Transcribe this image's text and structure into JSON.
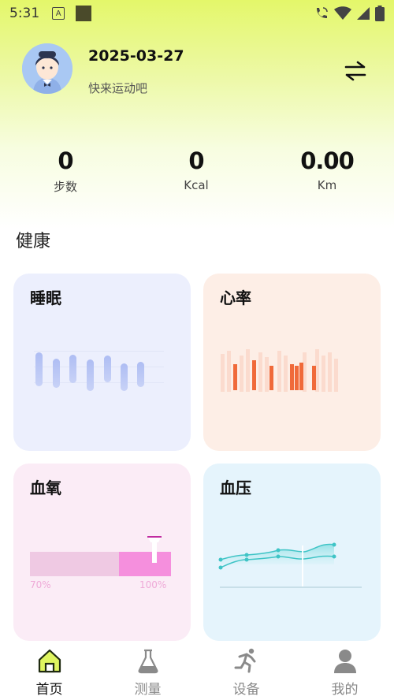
{
  "status_bar": {
    "time": "5:31",
    "a_glyph": "A"
  },
  "profile": {
    "date": "2025-03-27",
    "slogan": "快来运动吧"
  },
  "stats": [
    {
      "value": "0",
      "label": "步数"
    },
    {
      "value": "0",
      "label": "Kcal"
    },
    {
      "value": "0.00",
      "label": "Km"
    }
  ],
  "section_title": "健康",
  "cards": {
    "sleep": {
      "title": "睡眠"
    },
    "heart_rate": {
      "title": "心率"
    },
    "blood_oxygen": {
      "title": "血氧",
      "min_label": "70%",
      "max_label": "100%"
    },
    "blood_pressure": {
      "title": "血压"
    }
  },
  "nav": [
    {
      "label": "首页",
      "icon": "home-icon",
      "active": true
    },
    {
      "label": "测量",
      "icon": "flask-icon",
      "active": false
    },
    {
      "label": "设备",
      "icon": "running-person-icon",
      "active": false
    },
    {
      "label": "我的",
      "icon": "user-icon",
      "active": false
    }
  ],
  "colors": {
    "accent": "#dff560",
    "sleep_card": "#eceffd",
    "heart_card": "#fdeee6",
    "oxygen_card": "#fbecf6",
    "pressure_card": "#e5f4fc",
    "heart_bar": "#f06a3a",
    "sleep_bar": "#9fb0f0",
    "oxygen_fill": "#f58fdd",
    "pressure_line": "#3fc4c6"
  }
}
